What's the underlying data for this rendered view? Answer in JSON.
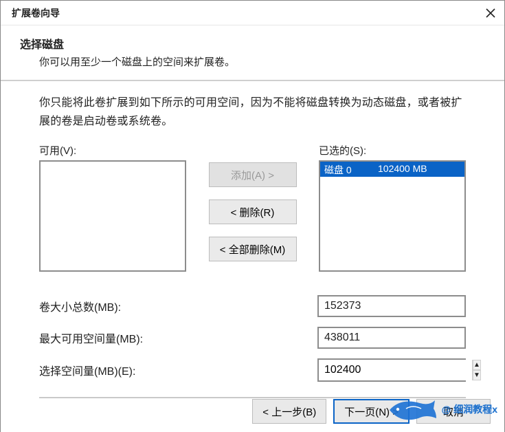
{
  "window": {
    "title": "扩展卷向导"
  },
  "header": {
    "heading": "选择磁盘",
    "sub": "你可以用至少一个磁盘上的空间来扩展卷。"
  },
  "info": "你只能将此卷扩展到如下所示的可用空间，因为不能将磁盘转换为动态磁盘，或者被扩展的卷是启动卷或系统卷。",
  "labels": {
    "available": "可用(V):",
    "selected": "已选的(S):",
    "add": "添加(A)  >",
    "remove": "<  删除(R)",
    "remove_all": "<  全部删除(M)",
    "total_label": "卷大小总数(MB):",
    "max_label": "最大可用空间量(MB):",
    "amount_label": "选择空间量(MB)(E):"
  },
  "selected_disk": {
    "name": "磁盘 0",
    "size": "102400 MB"
  },
  "values": {
    "total": "152373",
    "max": "438011",
    "amount": "102400"
  },
  "footer": {
    "back": "< 上一步(B)",
    "next": "下一页(N) >",
    "cancel": "取消"
  },
  "watermark": "@ 细润教程x"
}
